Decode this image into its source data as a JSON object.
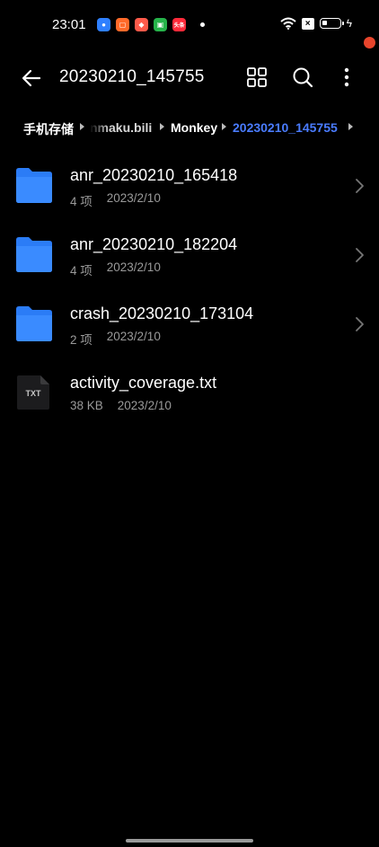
{
  "status_bar": {
    "time": "23:01",
    "battery_level": 0.3,
    "notification_icons": [
      "app-blue-icon",
      "app-orange-icon",
      "app-salmon-icon",
      "app-green-icon",
      "app-red-icon"
    ],
    "red_badge_text": "头条"
  },
  "toolbar": {
    "title": "20230210_145755"
  },
  "breadcrumb": {
    "items": [
      {
        "label": "手机存储"
      },
      {
        "label": "nmaku.bili"
      },
      {
        "label": "Monkey"
      },
      {
        "label": "20230210_145755"
      }
    ]
  },
  "files": [
    {
      "name": "anr_20230210_165418",
      "count": "4 项",
      "date": "2023/2/10",
      "type": "folder"
    },
    {
      "name": "anr_20230210_182204",
      "count": "4 项",
      "date": "2023/2/10",
      "type": "folder"
    },
    {
      "name": "crash_20230210_173104",
      "count": "2 项",
      "date": "2023/2/10",
      "type": "folder"
    },
    {
      "name": "activity_coverage.txt",
      "size": "38 KB",
      "date": "2023/2/10",
      "type": "txt",
      "badge": "TXT"
    }
  ],
  "colors": {
    "accent": "#4a7cff",
    "folder": "#2b7cf6",
    "background": "#000000",
    "secondary_text": "#9a9a9a"
  }
}
